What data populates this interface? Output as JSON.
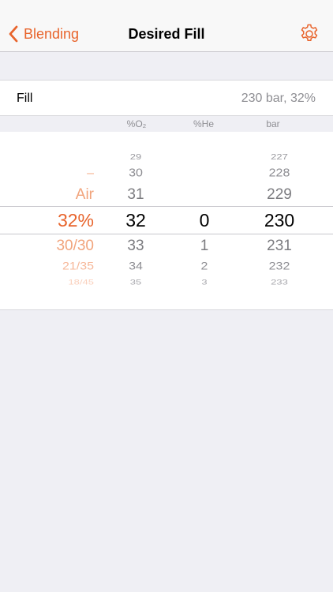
{
  "nav": {
    "back_label": "Blending",
    "title": "Desired Fill"
  },
  "fill": {
    "label": "Fill",
    "value": "230 bar, 32%"
  },
  "columns": {
    "o2": "%O₂",
    "he": "%He",
    "bar": "bar"
  },
  "picker": {
    "gas_above": [
      "–",
      "Air"
    ],
    "gas_selected": "32%",
    "gas_below": [
      "30/30",
      "21/35",
      "18/45"
    ],
    "o2_above": [
      "29",
      "30",
      "31"
    ],
    "o2_selected": "32",
    "o2_below": [
      "33",
      "34",
      "35"
    ],
    "he_selected": "0",
    "he_below": [
      "1",
      "2",
      "3"
    ],
    "bar_above": [
      "227",
      "228",
      "229"
    ],
    "bar_selected": "230",
    "bar_below": [
      "231",
      "232",
      "233"
    ]
  },
  "colors": {
    "accent": "#e8642c",
    "secondary_text": "#8e8e93",
    "background": "#efeff4"
  }
}
